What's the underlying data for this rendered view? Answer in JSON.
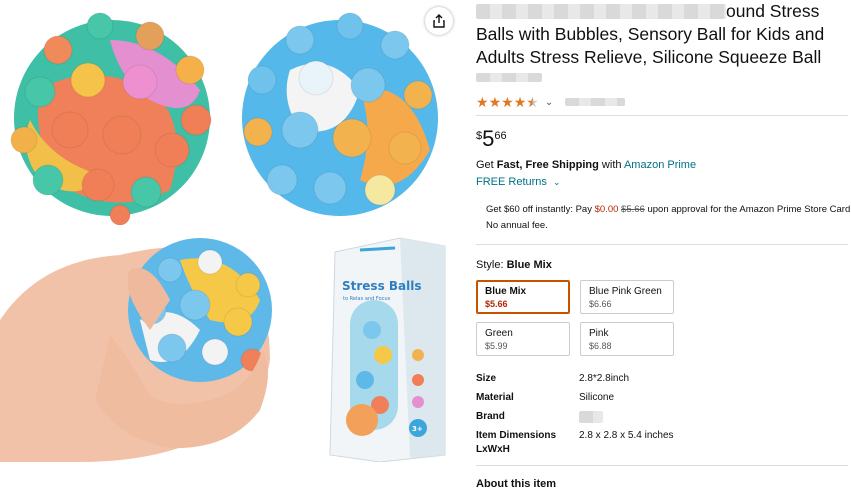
{
  "product": {
    "title_visible": "ound Stress Balls with Bubbles, Sensory Ball for Kids and Adults Stress Relieve, Silicone Squeeze Ball",
    "rating_stars": 4.5,
    "price": {
      "symbol": "$",
      "whole": "5",
      "fraction": "66"
    },
    "shipping": {
      "prefix": "Get ",
      "bold": "Fast, Free Shipping",
      "mid": " with ",
      "link": "Amazon Prime"
    },
    "returns": "FREE Returns",
    "promo": {
      "text1": "Get $60 off instantly: Pay ",
      "pay": "$0.00",
      "strike": "$5.66",
      "text2": " upon approval for the Amazon Prime Store Card. No annual fee."
    },
    "style": {
      "label": "Style: ",
      "value": "Blue Mix"
    },
    "swatches": [
      {
        "name": "Blue Mix",
        "price": "$5.66",
        "selected": true
      },
      {
        "name": "Blue Pink Green",
        "price": "$6.66",
        "selected": false
      },
      {
        "name": "Green",
        "price": "$5.99",
        "selected": false
      },
      {
        "name": "Pink",
        "price": "$6.88",
        "selected": false
      }
    ],
    "specs": [
      {
        "key": "Size",
        "value": "2.8*2.8inch"
      },
      {
        "key": "Material",
        "value": "Silicone"
      },
      {
        "key": "Brand",
        "value": ""
      },
      {
        "key": "Item Dimensions LxWxH",
        "value": "2.8 x 2.8 x 5.4 inches"
      }
    ],
    "about_heading": "About this item",
    "package_text": {
      "brand_title": "Stress Balls",
      "subtitle": "to Relax and Focus",
      "age": "3+"
    }
  },
  "colors": {
    "star": "#DE7921",
    "link": "#007185",
    "selected_border": "#C45500",
    "deal_price": "#B12704"
  },
  "icons": {
    "share": "share-icon"
  }
}
